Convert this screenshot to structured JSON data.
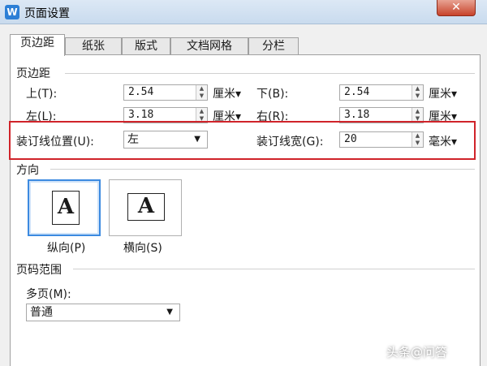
{
  "window": {
    "title": "页面设置",
    "app_icon": "W",
    "close": "✕"
  },
  "tabs": [
    "页边距",
    "纸张",
    "版式",
    "文档网格",
    "分栏"
  ],
  "margins": {
    "group": "页边距",
    "top_label": "上(T):",
    "top_value": "2.54",
    "top_unit": "厘米▾",
    "bottom_label": "下(B):",
    "bottom_value": "2.54",
    "bottom_unit": "厘米▾",
    "left_label": "左(L):",
    "left_value": "3.18",
    "left_unit": "厘米▾",
    "right_label": "右(R):",
    "right_value": "3.18",
    "right_unit": "厘米▾",
    "gutter_pos_label": "装订线位置(U):",
    "gutter_pos_value": "左",
    "gutter_width_label": "装订线宽(G):",
    "gutter_width_value": "20",
    "gutter_width_unit": "毫米▾"
  },
  "orientation": {
    "group": "方向",
    "portrait_label": "纵向(P)",
    "landscape_label": "横向(S)",
    "icon_letter": "A",
    "selected": "portrait"
  },
  "pages": {
    "group": "页码范围",
    "multi_label": "多页(M):",
    "multi_value": "普通"
  },
  "watermark": "头条@问答",
  "colors": {
    "highlight": "#d0232a",
    "accent": "#3c8ae0"
  }
}
